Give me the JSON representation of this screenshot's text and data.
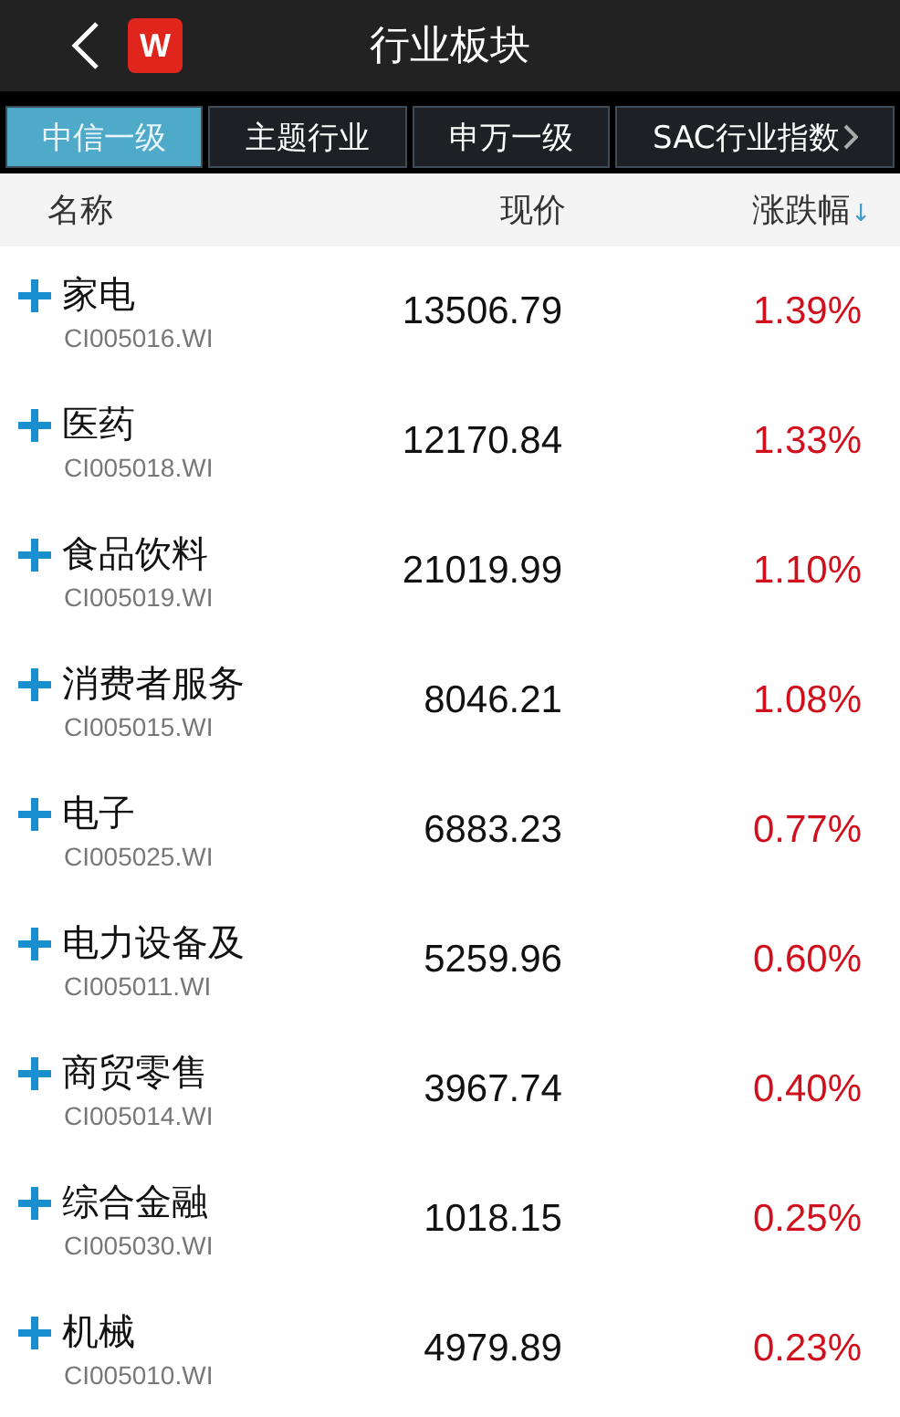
{
  "header": {
    "title": "行业板块",
    "logo": "W"
  },
  "tabs": [
    {
      "label": "中信一级",
      "selected": true
    },
    {
      "label": "主题行业",
      "selected": false
    },
    {
      "label": "申万一级",
      "selected": false
    },
    {
      "label": "SAC行业指数",
      "selected": false
    }
  ],
  "table": {
    "columns": [
      "名称",
      "现价",
      "涨跌幅"
    ],
    "sort_indicator": "↓",
    "rows": [
      {
        "name": "家电",
        "code": "CI005016.WI",
        "price": "13506.79",
        "change": "1.39%",
        "expanded": false
      },
      {
        "name": "医药",
        "code": "CI005018.WI",
        "price": "12170.84",
        "change": "1.33%",
        "expanded": false
      },
      {
        "name": "食品饮料",
        "code": "CI005019.WI",
        "price": "21019.99",
        "change": "1.10%",
        "expanded": false
      },
      {
        "name": "消费者服务",
        "code": "CI005015.WI",
        "price": "8046.21",
        "change": "1.08%",
        "expanded": false
      },
      {
        "name": "电子",
        "code": "CI005025.WI",
        "price": "6883.23",
        "change": "0.77%",
        "expanded": false
      },
      {
        "name": "电力设备及",
        "code": "CI005011.WI",
        "price": "5259.96",
        "change": "0.60%",
        "expanded": false
      },
      {
        "name": "商贸零售",
        "code": "CI005014.WI",
        "price": "3967.74",
        "change": "0.40%",
        "expanded": false
      },
      {
        "name": "综合金融",
        "code": "CI005030.WI",
        "price": "1018.15",
        "change": "0.25%",
        "expanded": false
      },
      {
        "name": "机械",
        "code": "CI005010.WI",
        "price": "4979.89",
        "change": "0.23%",
        "expanded": false
      }
    ]
  }
}
